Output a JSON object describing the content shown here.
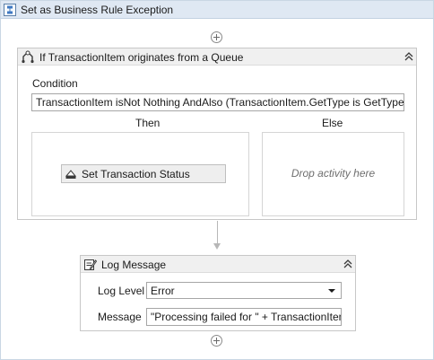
{
  "sequence": {
    "title": "Set as Business Rule Exception",
    "icon": "sequence-icon"
  },
  "if_activity": {
    "title": "If TransactionItem originates from a Queue",
    "icon": "if-icon",
    "condition_label": "Condition",
    "condition_value": "TransactionItem isNot Nothing AndAlso (TransactionItem.GetType is GetType(Uipatl",
    "then_label": "Then",
    "else_label": "Else",
    "else_placeholder": "Drop activity here",
    "then_activity": {
      "label": "Set Transaction Status",
      "icon": "set-transaction-status-icon"
    }
  },
  "log_message": {
    "title": "Log Message",
    "icon": "log-message-icon",
    "level_label": "Log Level",
    "level_value": "Error",
    "message_label": "Message",
    "message_value": "\"Processing failed for \" + TransactionItem.T"
  },
  "colors": {
    "sequence_header_bg": "#dfe8f3",
    "activity_header_bg": "#f0f0f0",
    "border": "#c7c7c7"
  }
}
